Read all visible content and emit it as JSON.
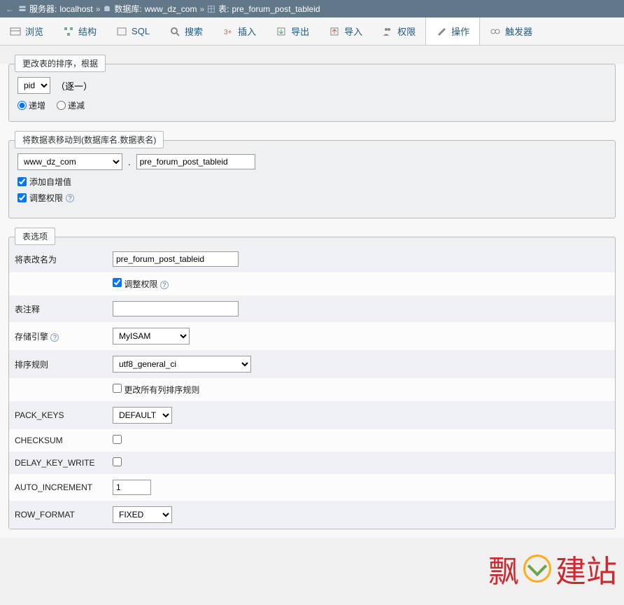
{
  "breadcrumb": {
    "server_label": "服务器:",
    "server_value": "localhost",
    "database_label": "数据库:",
    "database_value": "www_dz_com",
    "table_label": "表:",
    "table_value": "pre_forum_post_tableid"
  },
  "tabs": {
    "browse": "浏览",
    "structure": "结构",
    "sql": "SQL",
    "search": "搜索",
    "insert": "插入",
    "export": "导出",
    "import": "导入",
    "privileges": "权限",
    "operations": "操作",
    "triggers": "触发器"
  },
  "panel1": {
    "title": "更改表的排序，根据",
    "sort_field": "pid",
    "hint": "（逐一）",
    "asc": "递增",
    "desc": "递减"
  },
  "panel2": {
    "title": "将数据表移动到(数据库名.数据表名)",
    "db_select": "www_dz_com",
    "dot": ".",
    "table_name": "pre_forum_post_tableid",
    "add_auto": "添加自增值",
    "adjust_priv": "调整权限"
  },
  "panel3": {
    "title": "表选项",
    "rename_label": "将表改名为",
    "rename_value": "pre_forum_post_tableid",
    "adjust_priv": "调整权限",
    "comment_label": "表注释",
    "comment_value": "",
    "engine_label": "存储引擎",
    "engine_value": "MyISAM",
    "collation_label": "排序规则",
    "collation_value": "utf8_general_ci",
    "change_all_cols": "更改所有列排序规则",
    "pack_keys_label": "PACK_KEYS",
    "pack_keys_value": "DEFAULT",
    "checksum_label": "CHECKSUM",
    "delay_key_label": "DELAY_KEY_WRITE",
    "auto_inc_label": "AUTO_INCREMENT",
    "auto_inc_value": "1",
    "row_format_label": "ROW_FORMAT",
    "row_format_value": "FIXED"
  },
  "watermark": {
    "left": "飘",
    "right": "建站"
  }
}
